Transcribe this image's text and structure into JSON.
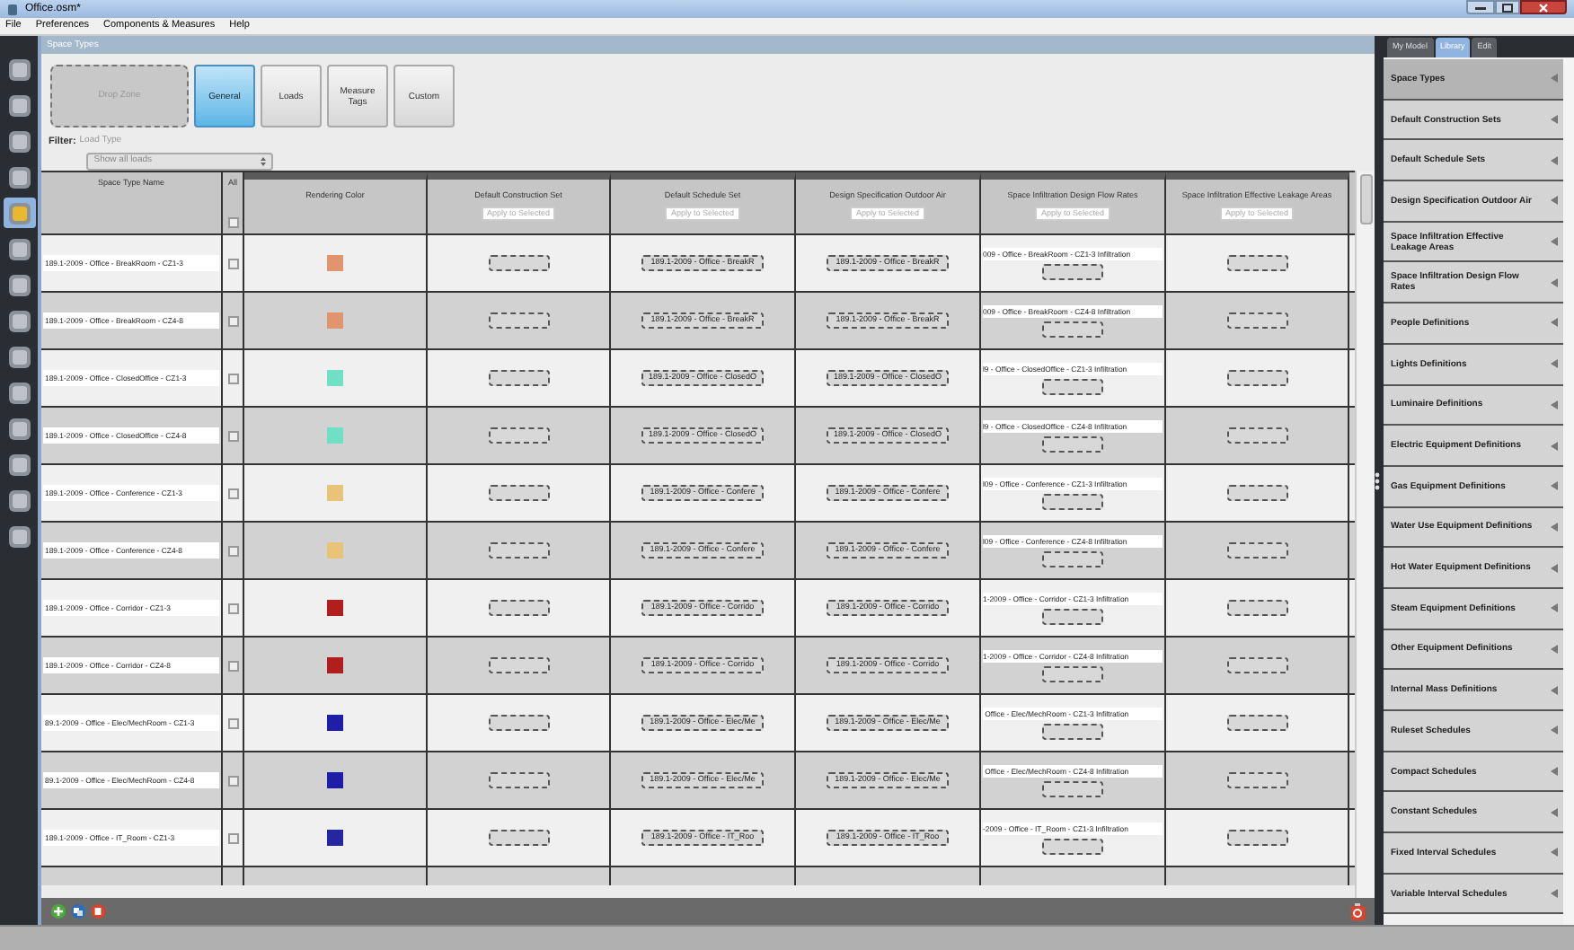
{
  "window": {
    "title": "Office.osm*"
  },
  "menu": [
    "File",
    "Preferences",
    "Components & Measures",
    "Help"
  ],
  "left_toolbar": [
    {
      "selected": false
    },
    {
      "selected": false
    },
    {
      "selected": false
    },
    {
      "selected": false
    },
    {
      "selected": true
    },
    {
      "selected": false
    },
    {
      "selected": false
    },
    {
      "selected": false
    },
    {
      "selected": false
    },
    {
      "selected": false
    },
    {
      "selected": false
    },
    {
      "selected": false
    },
    {
      "selected": false
    },
    {
      "selected": false
    }
  ],
  "panel_title": "Space Types",
  "drop_zone": "Drop Zone",
  "view_buttons": [
    {
      "label": "General",
      "selected": true
    },
    {
      "label": "Loads",
      "selected": false
    },
    {
      "label": "Measure Tags",
      "selected": false
    },
    {
      "label": "Custom",
      "selected": false
    }
  ],
  "filter": {
    "label": "Filter:",
    "field_label": "Load Type",
    "value": "Show all loads"
  },
  "table": {
    "select_all_checked": false,
    "columns": [
      {
        "label": "Space Type Name"
      },
      {
        "label": "All"
      },
      {
        "label": "Rendering Color"
      },
      {
        "label": "Default Construction Set",
        "action": "Apply to Selected"
      },
      {
        "label": "Default Schedule Set",
        "action": "Apply to Selected"
      },
      {
        "label": "Design Specification Outdoor Air",
        "action": "Apply to Selected"
      },
      {
        "label": "Space Infiltration Design Flow Rates",
        "action": "Apply to Selected"
      },
      {
        "label": "Space Infiltration Effective Leakage Areas",
        "action": "Apply to Selected"
      }
    ],
    "rows": [
      {
        "name": "189.1-2009 - Office - BreakRoom - CZ1-3",
        "checked": false,
        "color": "#e0956e",
        "schedule_set": "189.1-2009 - Office - BreakR",
        "outdoor_air": "189.1-2009 - Office - BreakR",
        "infiltration": "009 - Office - BreakRoom - CZ1-3 Infiltration"
      },
      {
        "name": "189.1-2009 - Office - BreakRoom - CZ4-8",
        "checked": false,
        "color": "#e0956e",
        "schedule_set": "189.1-2009 - Office - BreakR",
        "outdoor_air": "189.1-2009 - Office - BreakR",
        "infiltration": "009 - Office - BreakRoom - CZ4-8 Infiltration"
      },
      {
        "name": "189.1-2009 - Office - ClosedOffice - CZ1-3",
        "checked": false,
        "color": "#70e0c4",
        "schedule_set": "189.1-2009 - Office - ClosedO",
        "outdoor_air": "189.1-2009 - Office - ClosedO",
        "infiltration": "l9 - Office - ClosedOffice - CZ1-3 Infiltration"
      },
      {
        "name": "189.1-2009 - Office - ClosedOffice - CZ4-8",
        "checked": false,
        "color": "#70e0c4",
        "schedule_set": "189.1-2009 - Office - ClosedO",
        "outdoor_air": "189.1-2009 - Office - ClosedO",
        "infiltration": "l9 - Office - ClosedOffice - CZ4-8 Infiltration"
      },
      {
        "name": "189.1-2009 - Office - Conference - CZ1-3",
        "checked": false,
        "color": "#e8c478",
        "schedule_set": "189.1-2009 - Office - Confere",
        "outdoor_air": "189.1-2009 - Office - Confere",
        "infiltration": "l09 - Office - Conference - CZ1-3 Infiltration"
      },
      {
        "name": "189.1-2009 - Office - Conference - CZ4-8",
        "checked": false,
        "color": "#e8c478",
        "schedule_set": "189.1-2009 - Office - Confere",
        "outdoor_air": "189.1-2009 - Office - Confere",
        "infiltration": "l09 - Office - Conference - CZ4-8 Infiltration"
      },
      {
        "name": "189.1-2009 - Office - Corridor - CZ1-3",
        "checked": false,
        "color": "#b01e1e",
        "schedule_set": "189.1-2009 - Office - Corrido",
        "outdoor_air": "189.1-2009 - Office - Corrido",
        "infiltration": "1-2009 - Office - Corridor - CZ1-3 Infiltration"
      },
      {
        "name": "189.1-2009 - Office - Corridor - CZ4-8",
        "checked": false,
        "color": "#b01e1e",
        "schedule_set": "189.1-2009 - Office - Corrido",
        "outdoor_air": "189.1-2009 - Office - Corrido",
        "infiltration": "1-2009 - Office - Corridor - CZ4-8 Infiltration"
      },
      {
        "name": "89.1-2009 - Office - Elec/MechRoom - CZ1-3",
        "checked": false,
        "color": "#1e1ea8",
        "schedule_set": "189.1-2009 - Office - Elec/Me",
        "outdoor_air": "189.1-2009 - Office - Elec/Me",
        "infiltration": " Office - Elec/MechRoom - CZ1-3 Infiltration"
      },
      {
        "name": "89.1-2009 - Office - Elec/MechRoom - CZ4-8",
        "checked": false,
        "color": "#1e1ea8",
        "schedule_set": "189.1-2009 - Office - Elec/Me",
        "outdoor_air": "189.1-2009 - Office - Elec/Me",
        "infiltration": " Office - Elec/MechRoom - CZ4-8 Infiltration"
      },
      {
        "name": "189.1-2009 - Office - IT_Room - CZ1-3",
        "checked": false,
        "color": "#2626a0",
        "schedule_set": "189.1-2009 - Office - IT_Roo",
        "outdoor_air": "189.1-2009 - Office - IT_Roo",
        "infiltration": "-2009 - Office - IT_Room - CZ1-3 Infiltration"
      }
    ]
  },
  "right_tabs": [
    {
      "label": "My Model",
      "selected": false
    },
    {
      "label": "Library",
      "selected": true
    },
    {
      "label": "Edit",
      "selected": false
    }
  ],
  "library_items": [
    {
      "label": "Space Types",
      "selected": true
    },
    {
      "label": "Default Construction Sets",
      "selected": false
    },
    {
      "label": "Default Schedule Sets",
      "selected": false
    },
    {
      "label": "Design Specification Outdoor Air",
      "selected": false
    },
    {
      "label": "Space Infiltration Effective Leakage Areas",
      "selected": false
    },
    {
      "label": "Space Infiltration Design Flow Rates",
      "selected": false
    },
    {
      "label": "People Definitions",
      "selected": false
    },
    {
      "label": "Lights Definitions",
      "selected": false
    },
    {
      "label": "Luminaire Definitions",
      "selected": false
    },
    {
      "label": "Electric Equipment Definitions",
      "selected": false
    },
    {
      "label": "Gas Equipment Definitions",
      "selected": false
    },
    {
      "label": "Water Use Equipment Definitions",
      "selected": false
    },
    {
      "label": "Hot Water Equipment Definitions",
      "selected": false
    },
    {
      "label": "Steam Equipment Definitions",
      "selected": false
    },
    {
      "label": "Other Equipment Definitions",
      "selected": false
    },
    {
      "label": "Internal Mass Definitions",
      "selected": false
    },
    {
      "label": "Ruleset Schedules",
      "selected": false
    },
    {
      "label": "Compact Schedules",
      "selected": false
    },
    {
      "label": "Constant Schedules",
      "selected": false
    },
    {
      "label": "Fixed Interval Schedules",
      "selected": false
    },
    {
      "label": "Variable Interval Schedules",
      "selected": false
    }
  ]
}
